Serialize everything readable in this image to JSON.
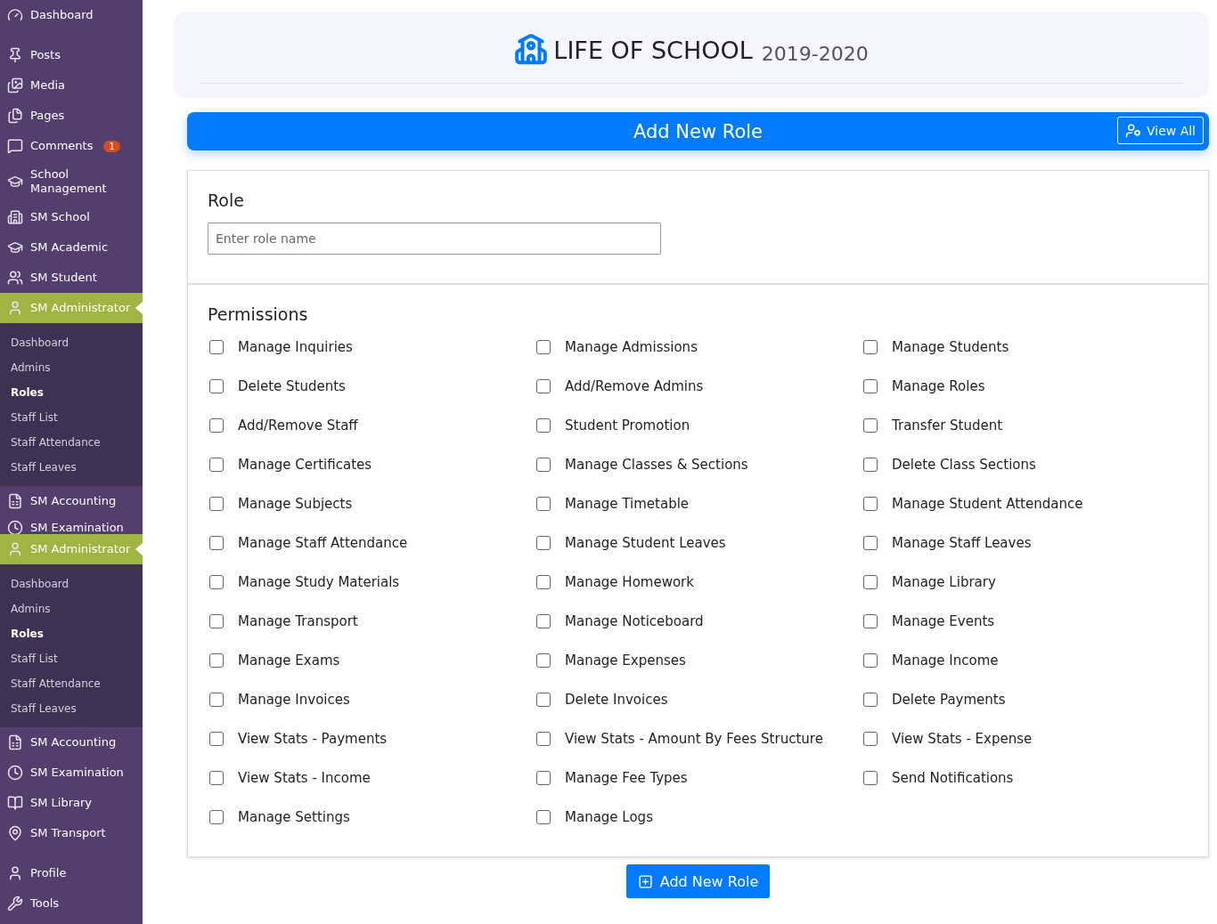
{
  "sidebar": {
    "groups": [
      [
        {
          "label": "Dashboard",
          "current": false
        }
      ],
      [
        {
          "label": "Posts",
          "current": false
        },
        {
          "label": "Media",
          "current": false
        },
        {
          "label": "Pages",
          "current": false
        },
        {
          "label": "Comments",
          "current": false,
          "badge": "1"
        },
        {
          "label": "School Management",
          "current": false
        },
        {
          "label": "SM School",
          "current": false
        },
        {
          "label": "SM Academic",
          "current": false
        },
        {
          "label": "SM Student",
          "current": false
        },
        {
          "label": "SM Administrator",
          "current": true,
          "children": [
            {
              "label": "Dashboard",
              "selected": false
            },
            {
              "label": "Admins",
              "selected": false
            },
            {
              "label": "Roles",
              "selected": true
            },
            {
              "label": "Staff List",
              "selected": false
            },
            {
              "label": "Staff Attendance",
              "selected": false
            },
            {
              "label": "Staff Leaves",
              "selected": false
            }
          ]
        },
        {
          "label": "SM Accounting",
          "current": false
        },
        {
          "label": "SM Examination",
          "current": false,
          "overlapped": true
        },
        {
          "label": "SM Administrator",
          "current": true,
          "children": [
            {
              "label": "Dashboard",
              "selected": false
            },
            {
              "label": "Admins",
              "selected": false
            },
            {
              "label": "Roles",
              "selected": true
            },
            {
              "label": "Staff List",
              "selected": false
            },
            {
              "label": "Staff Attendance",
              "selected": false
            },
            {
              "label": "Staff Leaves",
              "selected": false
            }
          ]
        },
        {
          "label": "SM Accounting",
          "current": false
        },
        {
          "label": "SM Examination",
          "current": false
        },
        {
          "label": "SM Library",
          "current": false
        },
        {
          "label": "SM Transport",
          "current": false
        }
      ],
      [
        {
          "label": "Profile",
          "current": false
        },
        {
          "label": "Tools",
          "current": false
        }
      ]
    ]
  },
  "header": {
    "title": "LIFE OF SCHOOL",
    "year": "2019-2020"
  },
  "role_bar": {
    "title": "Add New Role",
    "view_all": "View All"
  },
  "role": {
    "heading": "Role",
    "placeholder": "Enter role name"
  },
  "permissions": {
    "heading": "Permissions",
    "items": [
      {
        "label": "Manage Inquiries",
        "checked": false
      },
      {
        "label": "Manage Admissions",
        "checked": false
      },
      {
        "label": "Manage Students",
        "checked": false
      },
      {
        "label": "Delete Students",
        "checked": false
      },
      {
        "label": "Add/Remove Admins",
        "checked": false
      },
      {
        "label": "Manage Roles",
        "checked": false
      },
      {
        "label": "Add/Remove Staff",
        "checked": false
      },
      {
        "label": "Student Promotion",
        "checked": false
      },
      {
        "label": "Transfer Student",
        "checked": false
      },
      {
        "label": "Manage Certificates",
        "checked": false
      },
      {
        "label": "Manage Classes & Sections",
        "checked": false
      },
      {
        "label": "Delete Class Sections",
        "checked": false
      },
      {
        "label": "Manage Subjects",
        "checked": false
      },
      {
        "label": "Manage Timetable",
        "checked": false
      },
      {
        "label": "Manage Student Attendance",
        "checked": false
      },
      {
        "label": "Manage Staff Attendance",
        "checked": false
      },
      {
        "label": "Manage Student Leaves",
        "checked": false
      },
      {
        "label": "Manage Staff Leaves",
        "checked": false
      },
      {
        "label": "Manage Study Materials",
        "checked": false
      },
      {
        "label": "Manage Homework",
        "checked": false
      },
      {
        "label": "Manage Library",
        "checked": false
      },
      {
        "label": "Manage Transport",
        "checked": false
      },
      {
        "label": "Manage Noticeboard",
        "checked": false
      },
      {
        "label": "Manage Events",
        "checked": false
      },
      {
        "label": "Manage Exams",
        "checked": false
      },
      {
        "label": "Manage Expenses",
        "checked": false
      },
      {
        "label": "Manage Income",
        "checked": false
      },
      {
        "label": "Manage Invoices",
        "checked": false
      },
      {
        "label": "Delete Invoices",
        "checked": false
      },
      {
        "label": "Delete Payments",
        "checked": false
      },
      {
        "label": "View Stats - Payments",
        "checked": false
      },
      {
        "label": "View Stats - Amount By Fees Structure",
        "checked": false
      },
      {
        "label": "View Stats - Expense",
        "checked": false
      },
      {
        "label": "View Stats - Income",
        "checked": false
      },
      {
        "label": "Manage Fee Types",
        "checked": false
      },
      {
        "label": "Send Notifications",
        "checked": false
      },
      {
        "label": "Manage Settings",
        "checked": false
      },
      {
        "label": "Manage Logs",
        "checked": false
      }
    ]
  },
  "submit": "Add New Role"
}
